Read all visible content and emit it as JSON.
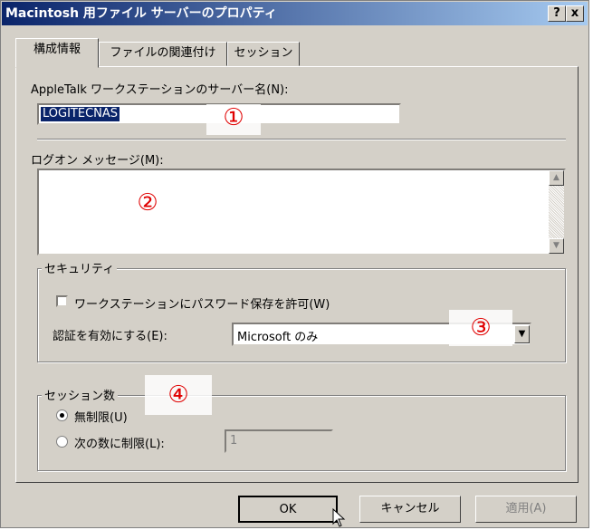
{
  "window": {
    "title": "Macintosh 用ファイル サーバーのプロパティ",
    "help_label": "?",
    "close_label": "x"
  },
  "tabs": [
    {
      "label": "構成情報"
    },
    {
      "label": "ファイルの関連付け"
    },
    {
      "label": "セッション"
    }
  ],
  "server_name": {
    "label": "AppleTalk ワークステーションのサーバー名(N):",
    "value": "LOGITECNAS",
    "marker": "①"
  },
  "logon_message": {
    "label": "ログオン メッセージ(M):",
    "value": "",
    "marker": "②"
  },
  "security": {
    "group_label": "セキュリティ",
    "password_checkbox_label": "ワークステーションにパスワード保存を許可(W)",
    "password_checked": false,
    "auth_label": "認証を有効にする(E):",
    "auth_value": "Microsoft のみ",
    "marker": "③"
  },
  "sessions": {
    "group_label": "セッション数",
    "unlimited_label": "無制限(U)",
    "limit_label": "次の数に制限(L):",
    "limit_value": "1",
    "selected": "unlimited",
    "marker": "④"
  },
  "buttons": {
    "ok": "OK",
    "cancel": "キャンセル",
    "apply": "適用(A)"
  },
  "colors": {
    "title_start": "#0a246a",
    "title_end": "#a6caf0",
    "face": "#d4d0c8",
    "marker": "#e00000"
  }
}
